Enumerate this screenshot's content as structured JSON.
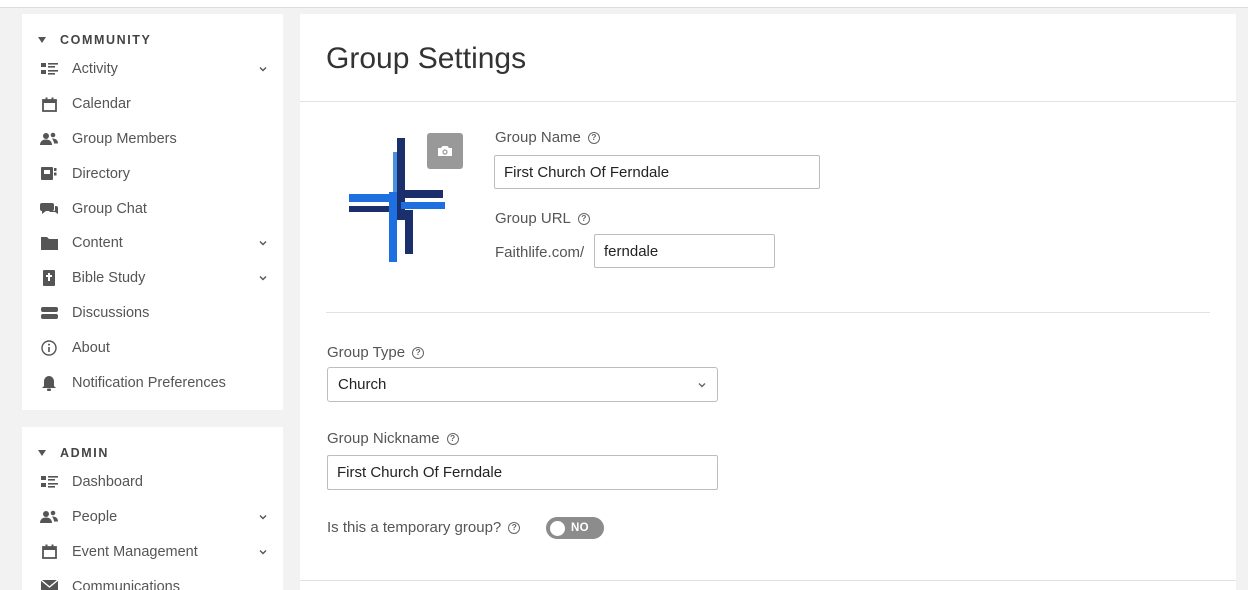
{
  "sidebar": {
    "community": {
      "heading": "COMMUNITY",
      "items": [
        {
          "label": "Activity",
          "icon": "activity-list-icon",
          "expandable": true
        },
        {
          "label": "Calendar",
          "icon": "calendar-icon",
          "expandable": false
        },
        {
          "label": "Group Members",
          "icon": "people-icon",
          "expandable": false
        },
        {
          "label": "Directory",
          "icon": "directory-icon",
          "expandable": false
        },
        {
          "label": "Group Chat",
          "icon": "chat-icon",
          "expandable": false
        },
        {
          "label": "Content",
          "icon": "folder-icon",
          "expandable": true
        },
        {
          "label": "Bible Study",
          "icon": "bible-icon",
          "expandable": true
        },
        {
          "label": "Discussions",
          "icon": "discussions-icon",
          "expandable": false
        },
        {
          "label": "About",
          "icon": "info-icon",
          "expandable": false
        },
        {
          "label": "Notification Preferences",
          "icon": "bell-icon",
          "expandable": false
        }
      ]
    },
    "admin": {
      "heading": "ADMIN",
      "items": [
        {
          "label": "Dashboard",
          "icon": "dashboard-icon",
          "expandable": false
        },
        {
          "label": "People",
          "icon": "people-icon",
          "expandable": true
        },
        {
          "label": "Event Management",
          "icon": "calendar-icon",
          "expandable": true
        },
        {
          "label": "Communications",
          "icon": "mail-icon",
          "expandable": false
        }
      ]
    }
  },
  "main": {
    "title": "Group Settings",
    "group_name": {
      "label": "Group Name",
      "help": "?",
      "value": "First Church Of Ferndale"
    },
    "group_url": {
      "label": "Group URL",
      "help": "?",
      "prefix": "Faithlife.com/",
      "value": "ferndale"
    },
    "group_type": {
      "label": "Group Type",
      "help": "?",
      "selected": "Church"
    },
    "group_nickname": {
      "label": "Group Nickname",
      "help": "?",
      "value": "First Church Of Ferndale"
    },
    "temporary": {
      "label": "Is this a temporary group?",
      "help": "?",
      "toggle_label": "NO"
    }
  },
  "colors": {
    "logo_dark": "#1a2f6b",
    "logo_blue": "#1e6fe0",
    "logo_light": "#4a90e2"
  }
}
